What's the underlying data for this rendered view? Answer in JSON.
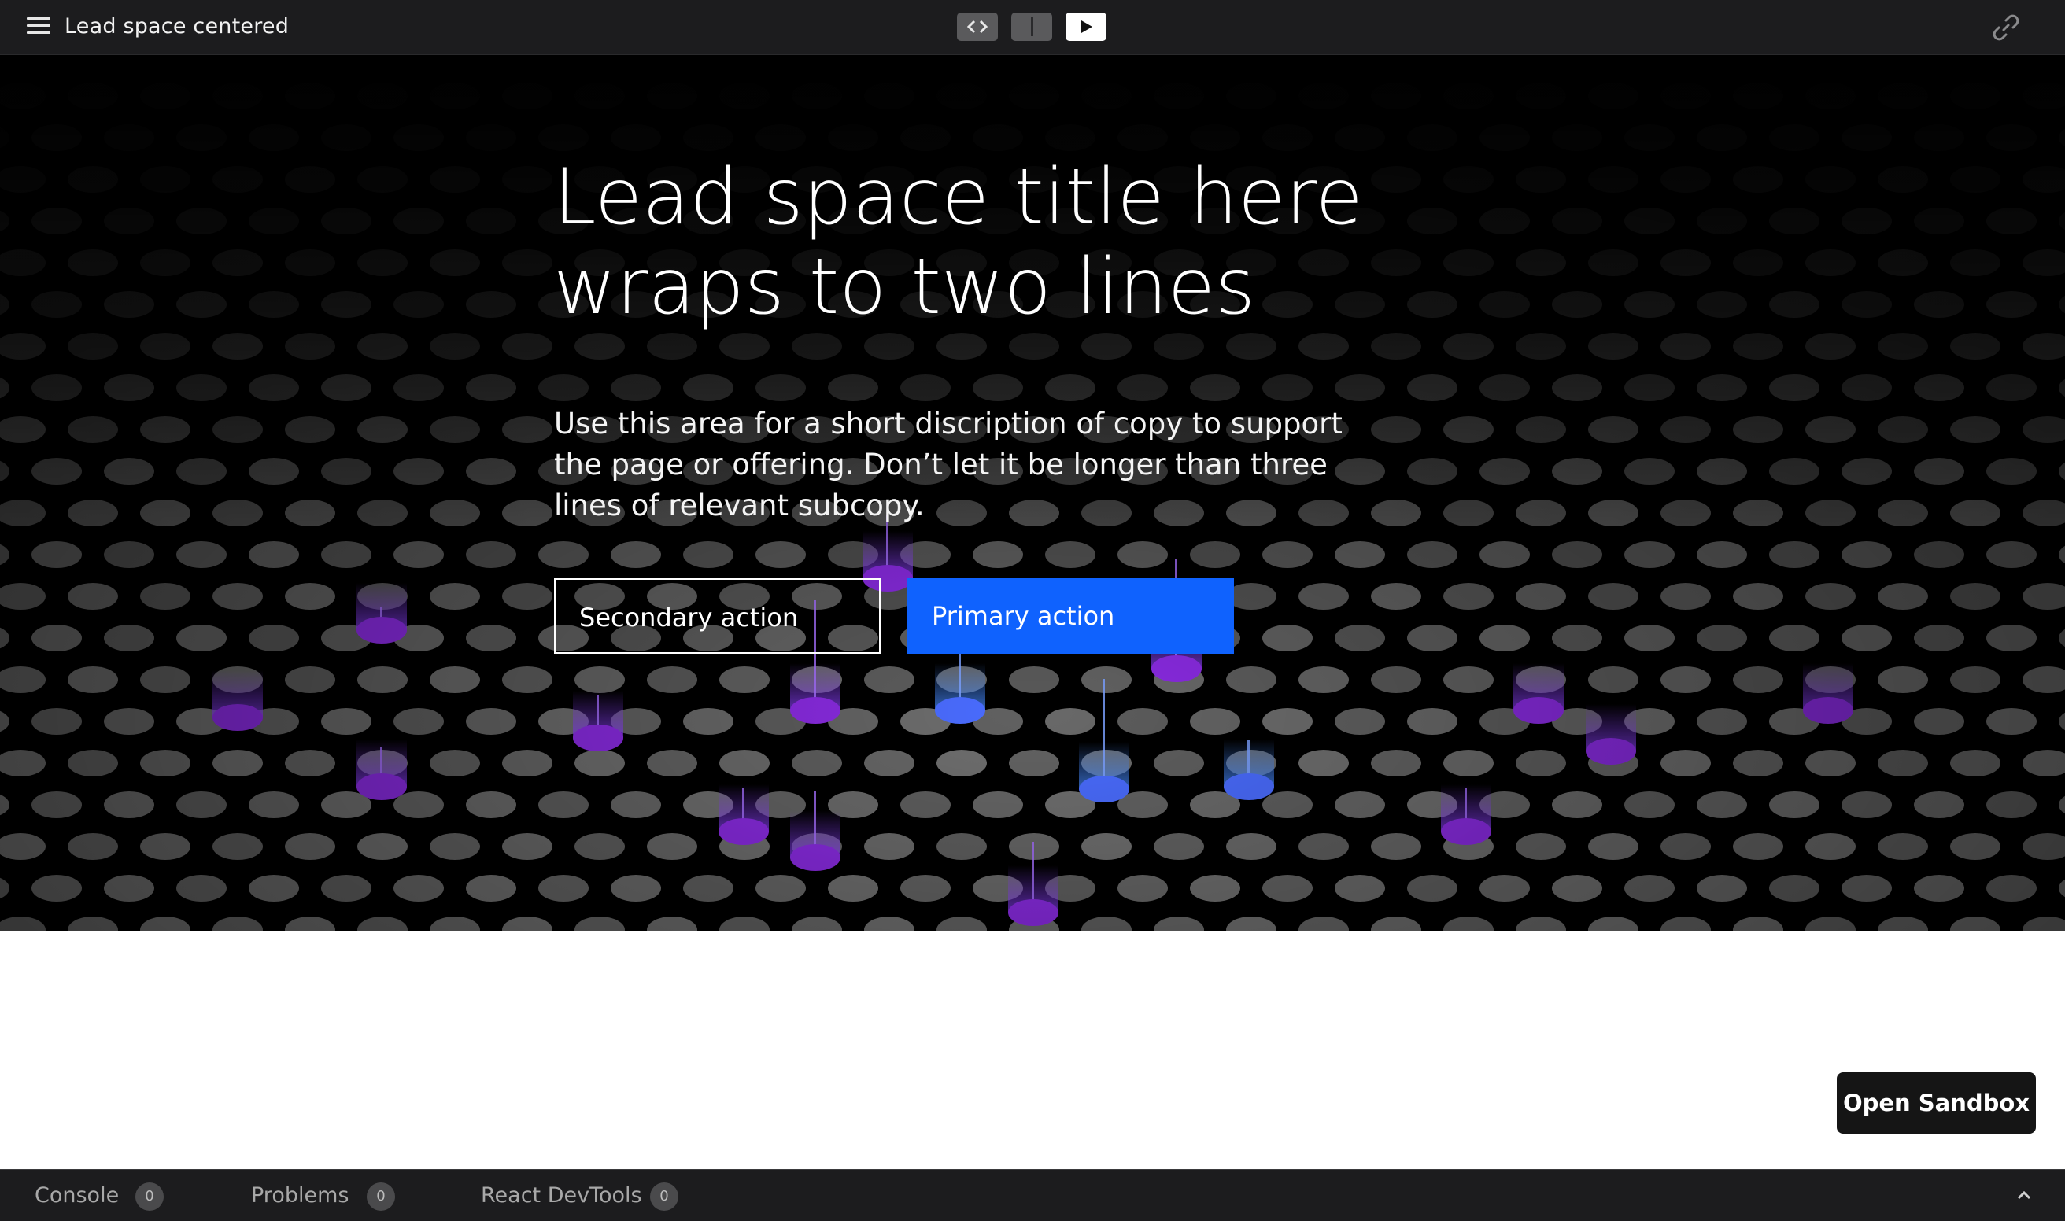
{
  "toolbar": {
    "title": "Lead space centered",
    "menu_icon": "hamburger-menu-icon",
    "view_buttons": [
      {
        "name": "code-view",
        "icon": "code-icon",
        "active": false
      },
      {
        "name": "split-view",
        "icon": "split-view-icon",
        "active": false
      },
      {
        "name": "preview-view",
        "icon": "play-icon",
        "active": true
      }
    ],
    "link_icon": "link-icon"
  },
  "hero": {
    "title_lines": [
      "Lead space title here",
      "wraps to two lines"
    ],
    "copy_lines": [
      "Use this area for a short discription of copy to support",
      "the page or offering. Don’t let it be longer than three",
      "lines of relevant subcopy."
    ],
    "secondary_action": "Secondary action",
    "primary_action": "Primary action",
    "colors": {
      "background": "#000000",
      "primary_button": "#0f62fe",
      "accent_purple": "#8a3ffc",
      "accent_blue": "#4589ff"
    }
  },
  "sandbox": {
    "label": "Open Sandbox"
  },
  "bottom_tabs": [
    {
      "label": "Console",
      "count": "0"
    },
    {
      "label": "Problems",
      "count": "0"
    },
    {
      "label": "React DevTools",
      "count": "0"
    }
  ]
}
